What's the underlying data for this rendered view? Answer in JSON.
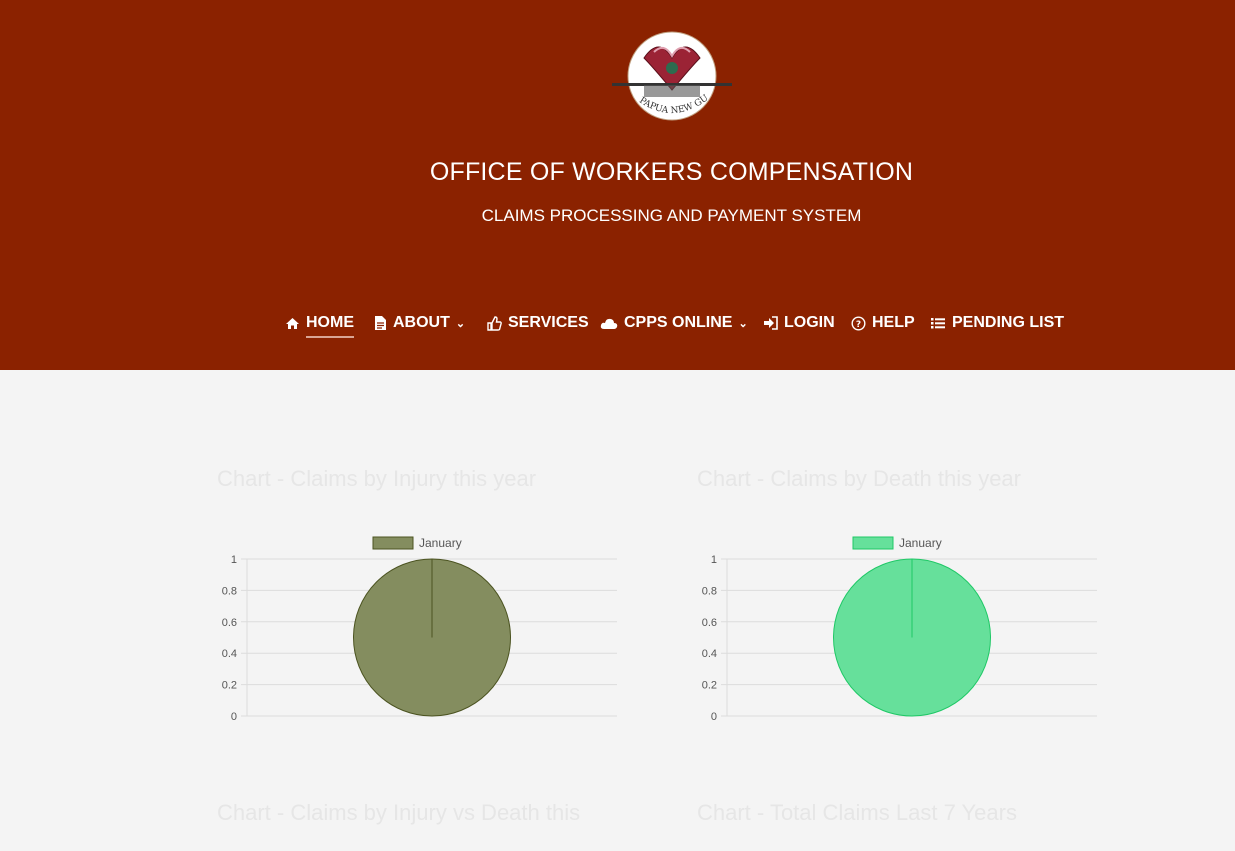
{
  "header": {
    "emblem_text": "PAPUA NEW GUINEA",
    "title": "OFFICE OF WORKERS COMPENSATION",
    "subtitle": "CLAIMS PROCESSING AND PAYMENT SYSTEM",
    "background_color": "#8b2200"
  },
  "nav": {
    "items": [
      {
        "label": "HOME",
        "icon": "home-icon",
        "active": true
      },
      {
        "label": "ABOUT",
        "icon": "document-icon",
        "dropdown": true
      },
      {
        "label": "SERVICES",
        "icon": "thumbs-up-icon"
      },
      {
        "label": "CPPS ONLINE",
        "icon": "cloud-icon",
        "dropdown": true
      },
      {
        "label": "LOGIN",
        "icon": "sign-in-icon"
      },
      {
        "label": "HELP",
        "icon": "question-circle-icon"
      },
      {
        "label": "PENDING LIST",
        "icon": "list-icon"
      }
    ]
  },
  "sections": {
    "injury_title": "Chart - Claims by Injury this year",
    "death_title": "Chart - Claims by Death this year",
    "injury_vs_death_title": "Chart - Claims by Injury vs Death this",
    "total_title": "Chart - Total Claims Last 7 Years"
  },
  "chart_data": [
    {
      "type": "pie",
      "title": "Chart - Claims by Injury this year",
      "categories": [
        "January"
      ],
      "values": [
        1
      ],
      "legend": [
        "January"
      ],
      "legend_placement": "top",
      "yticks": [
        "0",
        "0.2",
        "0.4",
        "0.6",
        "0.8",
        "1"
      ],
      "ylim": [
        0,
        1
      ],
      "grid": true,
      "fill_color": "#848d5f",
      "stroke_color": "#4b5320"
    },
    {
      "type": "pie",
      "title": "Chart - Claims by Death this year",
      "categories": [
        "January"
      ],
      "values": [
        1
      ],
      "legend": [
        "January"
      ],
      "legend_placement": "top",
      "yticks": [
        "0",
        "0.2",
        "0.4",
        "0.6",
        "0.8",
        "1"
      ],
      "ylim": [
        0,
        1
      ],
      "grid": true,
      "fill_color": "#66e09b",
      "stroke_color": "#1fc866"
    }
  ]
}
